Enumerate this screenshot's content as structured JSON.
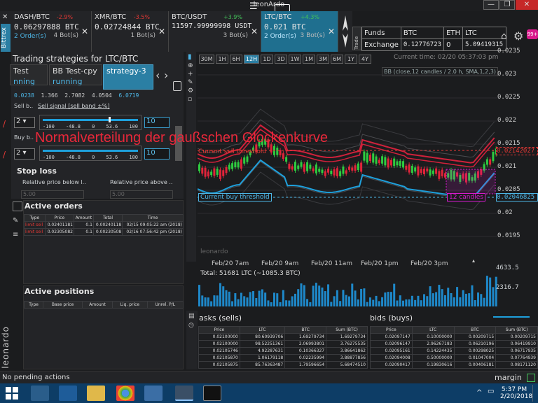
{
  "window": {
    "title": "leonArdo",
    "min": "—",
    "max": "❐",
    "close": "✕"
  },
  "tabs": [
    {
      "name": "DASH/BTC",
      "pct": "-2.9%",
      "price": "0.06297888 BTC",
      "orders": "2 Order(s)",
      "bots": "4 Bot(s)",
      "pct_color": "#e53935"
    },
    {
      "name": "XMR/BTC",
      "pct": "-3.5%",
      "price": "0.02724844 BTC",
      "orders": "",
      "bots": "1 Bot(s)",
      "pct_color": "#e53935"
    },
    {
      "name": "BTC/USDT",
      "pct": "+3.9%",
      "price": "11597.99999998 USDT",
      "orders": "",
      "bots": "3 Bot(s)",
      "pct_color": "#43c35a"
    },
    {
      "name": "LTC/BTC",
      "pct": "+4.3%",
      "price": "0.021 BTC",
      "orders": "2 Order(s)",
      "bots": "3 Bot(s)",
      "pct_color": "#43c35a"
    }
  ],
  "trade_label": "Trade",
  "funds": {
    "h": [
      "Funds",
      "BTC",
      "ETH",
      "LTC"
    ],
    "r": [
      "Exchange",
      "0.12776723",
      "0",
      "5.09419315"
    ]
  },
  "badge": "99+",
  "brand": "Bittrex",
  "strategies": {
    "title": "Trading strategies for LTC/BTC",
    "tabs": [
      {
        "n": "Test",
        "s": "nning"
      },
      {
        "n": "BB Test-cpy",
        "s": "running"
      },
      {
        "n": "strategy-3",
        "s": ""
      }
    ],
    "values": [
      "0.0238",
      "1.366",
      "2.7082",
      "4.0504",
      "6.0719"
    ],
    "sell_short": "Sell b..",
    "sell_signal": "Sell signal [sell band ±%]",
    "buy_short": "Buy b..",
    "sel1": "2",
    "sel2": "2",
    "scale": [
      "-100",
      "-48.8",
      "0",
      "53.6",
      "100"
    ],
    "input1": "10",
    "input2": "10",
    "stop_loss": "Stop loss",
    "rel_below": "Relative price below l..",
    "rel_above": "Relative price above ..",
    "ph": "5.00"
  },
  "overlay_text": "Normalverteilung der gaußschen Glockenkurve",
  "orders": {
    "title": "Active orders",
    "cols": [
      "Type",
      "Price",
      "Amount",
      "Total",
      "Time"
    ],
    "rows": [
      [
        "limit sell",
        "0.02401181",
        "0.1",
        "0.00240118",
        "02/15 09:05:22 am (2018)"
      ],
      [
        "limit sell",
        "0.02305082",
        "0.1",
        "0.00230508",
        "02/16 07:56:42 pm (2018)"
      ]
    ]
  },
  "positions": {
    "title": "Active positions",
    "cols": [
      "Type",
      "Base price",
      "Amount",
      "Liq. price",
      "Unrel. P/L"
    ]
  },
  "timeframes": [
    "30M",
    "1H",
    "6H",
    "12H",
    "1D",
    "3D",
    "1W",
    "1M",
    "3M",
    "6M",
    "1Y",
    "4Y"
  ],
  "selected_tf": "12H",
  "current_time": "Current time: 02/20 05:37:03 pm",
  "indicator": "BB (close,12 candles / 2.0 h, SMA,1,2,3)",
  "sell_threshold": "Current sell threshold",
  "buy_threshold": "Current buy threshold",
  "candles_label": "12 candles",
  "sell_price": "0.02142027",
  "buy_price": "0.02046825",
  "yaxis": [
    "0.0235",
    "0.023",
    "0.0225",
    "0.022",
    "0.0215",
    "0.021",
    "0.0205",
    "0.02",
    "0.0195"
  ],
  "xaxis": [
    "Feb/20 7am",
    "Feb/20 9am",
    "Feb/20 11am",
    "Feb/20 1pm",
    "Feb/20 3pm"
  ],
  "watermark": "leonardo",
  "volume": {
    "total": "Total: 51681 LTC (~1085.3 BTC)",
    "y1": "4633.5",
    "y2": "2316.7"
  },
  "asks": {
    "title": "asks (sells)",
    "cols": [
      "Price",
      "LTC",
      "BTC",
      "Sum (BTC)"
    ],
    "rows": [
      [
        "0.02100000",
        "80.60939706",
        "1.69279734",
        "1.69279734"
      ],
      [
        "0.02100000",
        "98.52251361",
        "2.06993801",
        "3.76275535"
      ],
      [
        "0.02105746",
        "4.92287631",
        "0.10366327",
        "3.86641862"
      ],
      [
        "0.02105870",
        "1.06179118",
        "0.02235994",
        "3.88877856"
      ],
      [
        "0.02105875",
        "85.76363487",
        "1.79596654",
        "5.68474510"
      ]
    ]
  },
  "bids": {
    "title": "bids (buys)",
    "cols": [
      "Price",
      "LTC",
      "BTC",
      "Sum (BTC)"
    ],
    "rows": [
      [
        "0.02097147",
        "0.10000000",
        "0.00209715",
        "0.00209715"
      ],
      [
        "0.02096147",
        "2.96267183",
        "0.06210196",
        "0.06419910"
      ],
      [
        "0.02095161",
        "0.14224435",
        "0.00298025",
        "0.06717935"
      ],
      [
        "0.02094008",
        "0.50000000",
        "0.01047004",
        "0.07764939"
      ],
      [
        "0.02090417",
        "0.19830616",
        "0.00406181",
        "0.08171120"
      ]
    ]
  },
  "status": "No pending actions",
  "margin_brand": "margin",
  "leonardo_vertical": "leonardo",
  "clock": {
    "time": "5:37 PM",
    "date": "2/20/2018"
  }
}
